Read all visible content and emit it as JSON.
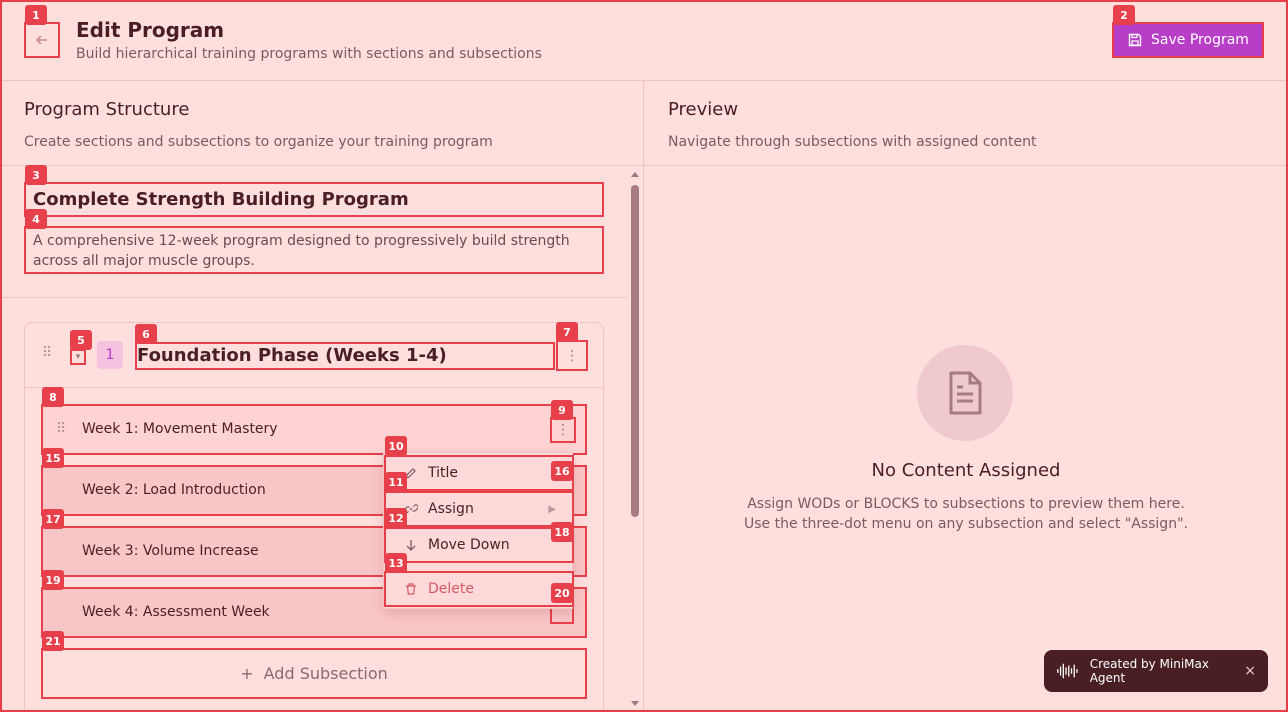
{
  "header": {
    "title": "Edit Program",
    "subtitle": "Build hierarchical training programs with sections and subsections",
    "save_label": "Save Program"
  },
  "structure_panel": {
    "title": "Program Structure",
    "description": "Create sections and subsections to organize your training program"
  },
  "preview_panel": {
    "title": "Preview",
    "description": "Navigate through subsections with assigned content",
    "empty_title": "No Content Assigned",
    "empty_line1": "Assign WODs or BLOCKS to subsections to preview them here.",
    "empty_line2": "Use the three-dot menu on any subsection and select \"Assign\"."
  },
  "program": {
    "title": "Complete Strength Building Program",
    "description": "A comprehensive 12-week program designed to progressively build strength across all major muscle groups."
  },
  "section": {
    "number": "1",
    "title": "Foundation Phase (Weeks 1-4)",
    "subsections": [
      {
        "label": "Week 1: Movement Mastery"
      },
      {
        "label": "Week 2: Load Introduction"
      },
      {
        "label": "Week 3: Volume Increase"
      },
      {
        "label": "Week 4: Assessment Week"
      }
    ],
    "add_label": "Add Subsection"
  },
  "menu": {
    "items": [
      {
        "label": "Title",
        "icon": "pencil-icon"
      },
      {
        "label": "Assign",
        "icon": "link-icon"
      },
      {
        "label": "Move Down",
        "icon": "arrow-down-icon"
      },
      {
        "label": "Delete",
        "icon": "trash-icon"
      }
    ]
  },
  "badge": {
    "label": "Created by MiniMax Agent",
    "close": "×"
  },
  "markers": [
    "1",
    "2",
    "3",
    "4",
    "5",
    "6",
    "7",
    "8",
    "9",
    "10",
    "11",
    "12",
    "13",
    "15",
    "16",
    "17",
    "18",
    "19",
    "20",
    "21"
  ],
  "colors": {
    "background": "#ffdede",
    "accent": "#b83ec7",
    "annotation": "#e8404a",
    "text": "#4a1f24"
  }
}
